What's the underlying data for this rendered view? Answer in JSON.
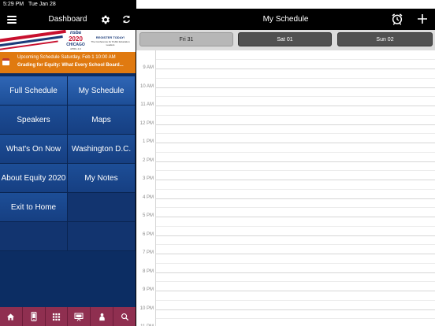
{
  "status_bar": {
    "time": "5:29 PM",
    "date": "Tue Jan 28",
    "battery": "100%"
  },
  "left_panel": {
    "title": "Dashboard",
    "banner": {
      "logo_line1": "nsba",
      "logo_line2": "2020",
      "logo_line3": "CHICAGO",
      "logo_line4": "APRIL 4-6",
      "register": "REGISTER TODAY!",
      "tagline": "The Conference for Public Education Leaders"
    },
    "upcoming": {
      "line1": "Upcoming Schedule Saturday, Feb 1 10:00 AM",
      "line2": "Grading for Equity: What Every School Board..."
    },
    "menu": [
      "Full Schedule",
      "My Schedule",
      "Speakers",
      "Maps",
      "What's On Now",
      "Washington D.C.",
      "About Equity 2020",
      "My Notes",
      "Exit to Home"
    ],
    "tabs": [
      "home-icon",
      "phone-icon",
      "grid-icon",
      "presentation-icon",
      "user-tree-icon",
      "search-icon"
    ]
  },
  "right_panel": {
    "title": "My Schedule",
    "days": [
      {
        "label": "Fri 31",
        "selected": true
      },
      {
        "label": "Sat 01",
        "selected": false
      },
      {
        "label": "Sun 02",
        "selected": false
      }
    ],
    "hours": [
      "9 AM",
      "10 AM",
      "11 AM",
      "12 PM",
      "1 PM",
      "2 PM",
      "3 PM",
      "4 PM",
      "5 PM",
      "6 PM",
      "7 PM",
      "8 PM",
      "9 PM",
      "10 PM",
      "11 PM"
    ]
  },
  "colors": {
    "menu_blue": "#1d4e97",
    "upcoming_orange": "#e07a10",
    "tab_bar": "#8f2f50"
  }
}
